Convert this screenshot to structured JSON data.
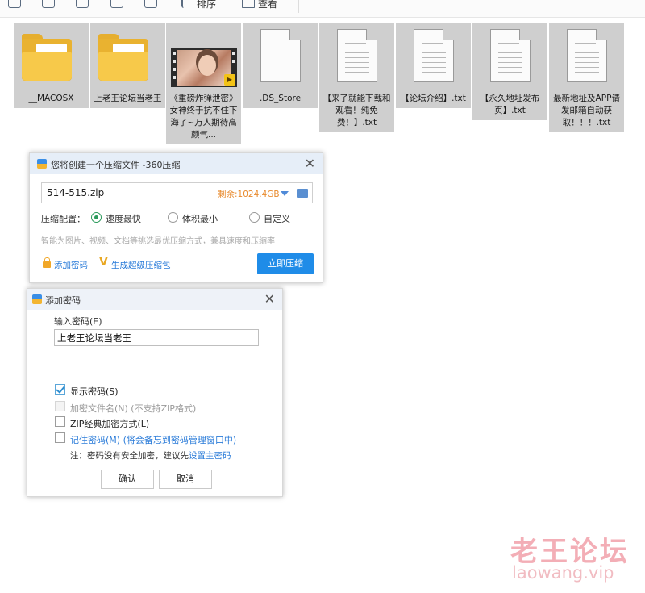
{
  "toolbar": {
    "sort_label": "排序",
    "view_label": "查看"
  },
  "files": [
    {
      "name": "__MACOSX",
      "icon": "folder-icon"
    },
    {
      "name": "上老王论坛当老王",
      "icon": "folder-icon"
    },
    {
      "name": "《重磅炸弹泄密》女神终于抗不住下海了~万人期待高颜气...",
      "icon": "video-thumbnail"
    },
    {
      "name": ".DS_Store",
      "icon": "blank-file-icon"
    },
    {
      "name": "【来了就能下载和观看！纯免费！】.txt",
      "icon": "text-file-icon"
    },
    {
      "name": "【论坛介绍】.txt",
      "icon": "text-file-icon"
    },
    {
      "name": "【永久地址发布页】.txt",
      "icon": "text-file-icon"
    },
    {
      "name": "最新地址及APP请发邮箱自动获取！！！.txt",
      "icon": "text-file-icon"
    }
  ],
  "zip_dialog": {
    "title": "您将创建一个压缩文件 -360压缩",
    "filename": "514-515.zip",
    "free_space": "剩余:1024.4GB",
    "config_label": "压缩配置：",
    "options": [
      {
        "label": "速度最快",
        "selected": true
      },
      {
        "label": "体积最小",
        "selected": false
      },
      {
        "label": "自定义",
        "selected": false
      }
    ],
    "hint": "智能为图片、视频、文档等挑选最优压缩方式，兼具速度和压缩率",
    "add_password": "添加密码",
    "super_pack": "生成超级压缩包",
    "compress_now": "立即压缩",
    "close": "✕"
  },
  "password_dialog": {
    "title": "添加密码",
    "input_label": "输入密码(E)",
    "password_value": "上老王论坛当老王",
    "checkboxes": [
      {
        "label": "显示密码(S)",
        "checked": true,
        "disabled": false
      },
      {
        "label": "加密文件名(N) (不支持ZIP格式)",
        "checked": false,
        "disabled": true
      },
      {
        "label": "ZIP经典加密方式(L)",
        "checked": false,
        "disabled": false
      },
      {
        "label": "记住密码(M) (将会备忘到密码管理窗口中)",
        "checked": false,
        "disabled": false
      }
    ],
    "note_prefix": "注：密码没有安全加密，建议先",
    "note_link": "设置主密码",
    "ok": "确认",
    "cancel": "取消",
    "close": "✕"
  },
  "watermark": {
    "text": "老王论坛",
    "url": "laowang.vip"
  },
  "colors": {
    "accent": "#1f8ce8",
    "radio_selected": "#2b9a5b",
    "free_space": "#e8892b",
    "link": "#2b7cd9",
    "watermark": "#f3aeb6"
  }
}
